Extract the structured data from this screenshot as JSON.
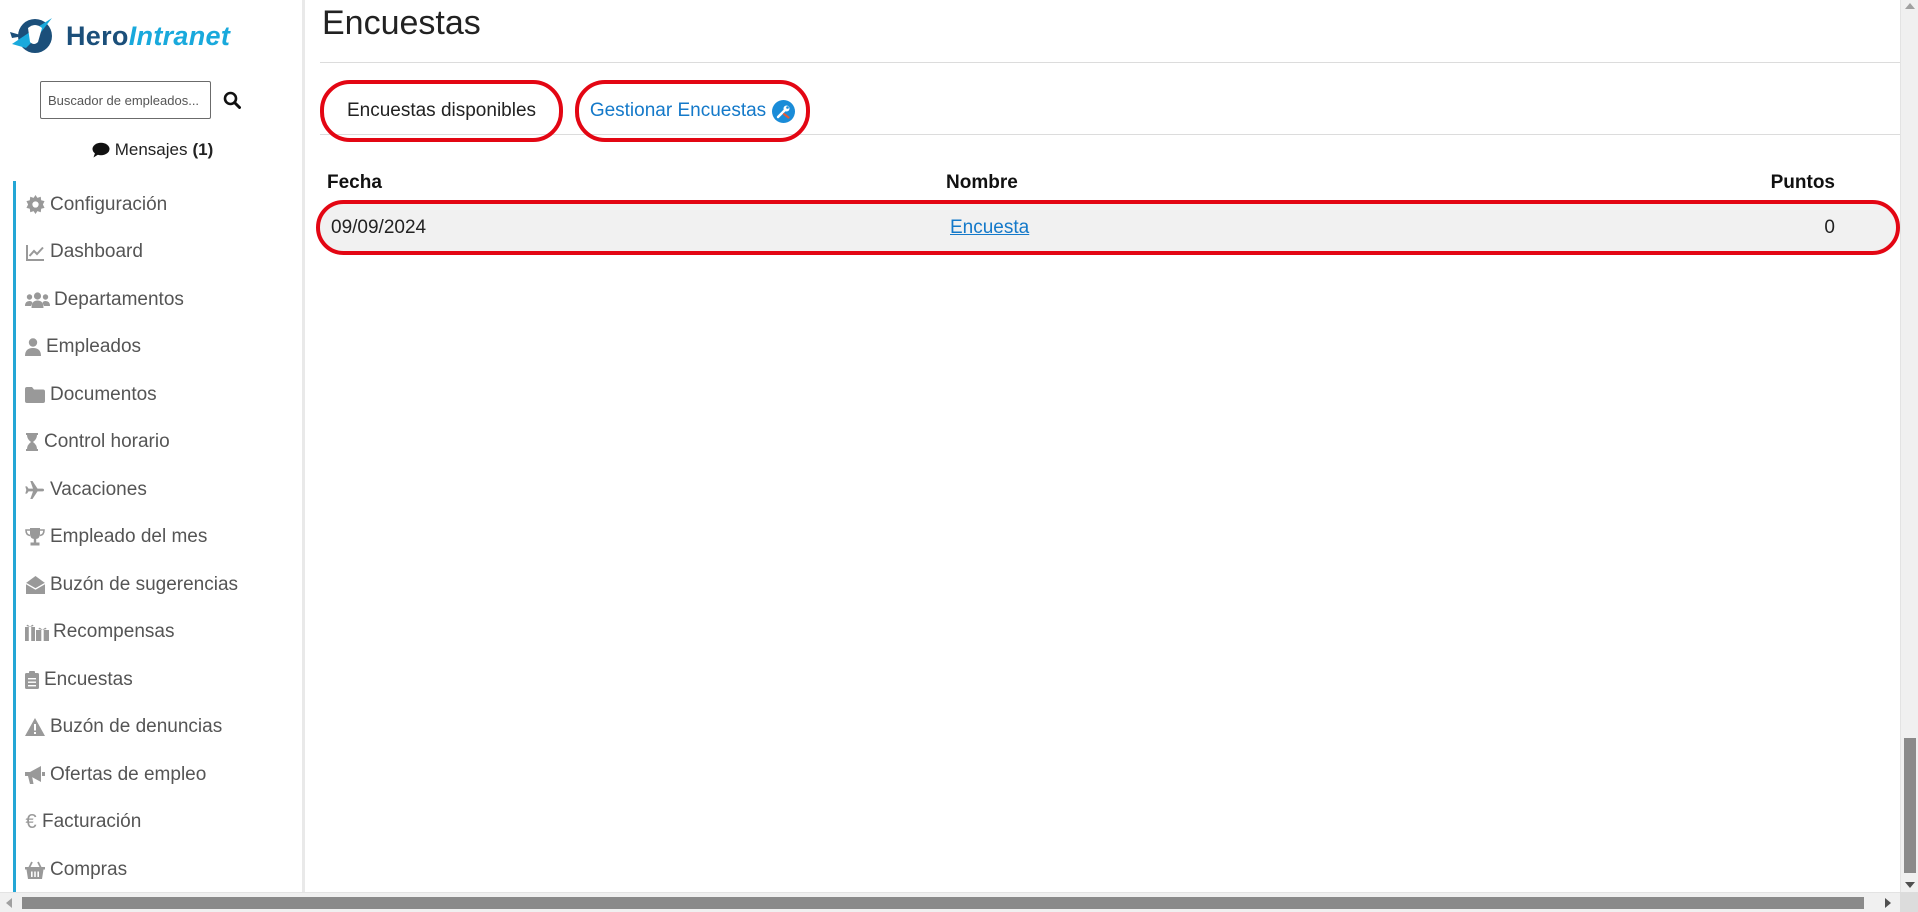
{
  "brand": {
    "name_part1": "Hero",
    "name_part2": "Intranet"
  },
  "search": {
    "placeholder": "Buscador de empleados..."
  },
  "messages": {
    "label": "Mensajes",
    "count": "(1)"
  },
  "sidebar": {
    "items": [
      {
        "label": "Configuración",
        "icon": "gear-icon"
      },
      {
        "label": "Dashboard",
        "icon": "chart-line-icon"
      },
      {
        "label": "Departamentos",
        "icon": "users-icon"
      },
      {
        "label": "Empleados",
        "icon": "user-icon"
      },
      {
        "label": "Documentos",
        "icon": "folder-icon"
      },
      {
        "label": "Control horario",
        "icon": "hourglass-icon"
      },
      {
        "label": "Vacaciones",
        "icon": "plane-icon"
      },
      {
        "label": "Empleado del mes",
        "icon": "trophy-icon"
      },
      {
        "label": "Buzón de sugerencias",
        "icon": "envelope-open-icon"
      },
      {
        "label": "Recompensas",
        "icon": "gifts-icon"
      },
      {
        "label": "Encuestas",
        "icon": "clipboard-list-icon"
      },
      {
        "label": "Buzón de denuncias",
        "icon": "warning-icon"
      },
      {
        "label": "Ofertas de empleo",
        "icon": "bullhorn-icon"
      },
      {
        "label": "Facturación",
        "icon": "euro-icon"
      },
      {
        "label": "Compras",
        "icon": "basket-icon"
      }
    ]
  },
  "main": {
    "title": "Encuestas",
    "tabs": [
      {
        "label": "Encuestas disponibles"
      },
      {
        "label": "Gestionar Encuestas"
      }
    ],
    "table": {
      "headers": {
        "date": "Fecha",
        "name": "Nombre",
        "points": "Puntos"
      },
      "rows": [
        {
          "date": "09/09/2024",
          "name": "Encuesta",
          "points": "0"
        }
      ]
    }
  },
  "colors": {
    "accent": "#23a6d5",
    "highlight": "#e30613",
    "link": "#1479c9",
    "brand_dark": "#1b4f7a",
    "brand_light": "#19a9dc"
  }
}
